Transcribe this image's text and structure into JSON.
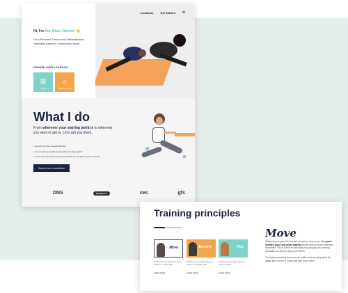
{
  "nav": {
    "locations": "Locations",
    "get_started": "Get Started",
    "menu_icon": "hamburger-icon"
  },
  "hero": {
    "greeting_prefix": "Hi, I'm ",
    "name": "Ben Blake Davies!",
    "wave": "👋",
    "bio": "I'm a Personal Trainer and Rehabilitation Specialist based in London and Hove.",
    "location_label": "CHOOSE YOUR LOCATION",
    "locations": [
      {
        "label": "London",
        "icon": "building-icon",
        "color": "#7fd4c9"
      },
      {
        "label": "Brighton Hove",
        "icon": "house-icon",
        "color": "#f2a64b"
      }
    ]
  },
  "what": {
    "title": "What I do",
    "subtitle_prefix": "From ",
    "subtitle_bold": "wherever your starting point is",
    "subtitle_suffix": " to wherever you want to get to. Let's get you there.",
    "bullets": [
      "• Recovering from a knee/back/hip?",
      "• Or just want to be able to play with your kids again?",
      "• Or are strong but want to develop functional strength for golf or tennis?"
    ],
    "button": "Book a free consultation"
  },
  "logos": [
    "DNS",
    "BrainForce",
    "ces",
    "gfs"
  ],
  "training": {
    "title": "Training principles",
    "tiles": [
      {
        "word": "Move",
        "desc": "Whatever your goal, the first step is to move well.",
        "learn": "Learn more"
      },
      {
        "word": "Breathe",
        "desc": "Whatever your goal, the first step is to breathe well.",
        "learn": "Learn more"
      },
      {
        "word": "Play",
        "desc": "Whatever your goal, the first step is to play.",
        "learn": "Learn more"
      }
    ],
    "heading": "Move",
    "text_1": "Whatever your goal, the first part of call is to ensure you have ",
    "text_bold": "good mobility, space and joints stability",
    "text_2": " and be able to create controlled movement. This is to help reduce injury risk and give you a strong foundation on which to build your fitness.",
    "text_3": "This helps everything from how you walk to how you play sport. An adage that I live by is \"Move well then move often.\""
  },
  "colors": {
    "navy": "#1c2340",
    "teal": "#7fd4c9",
    "orange": "#f2a64b",
    "bg": "#e6eeea"
  }
}
